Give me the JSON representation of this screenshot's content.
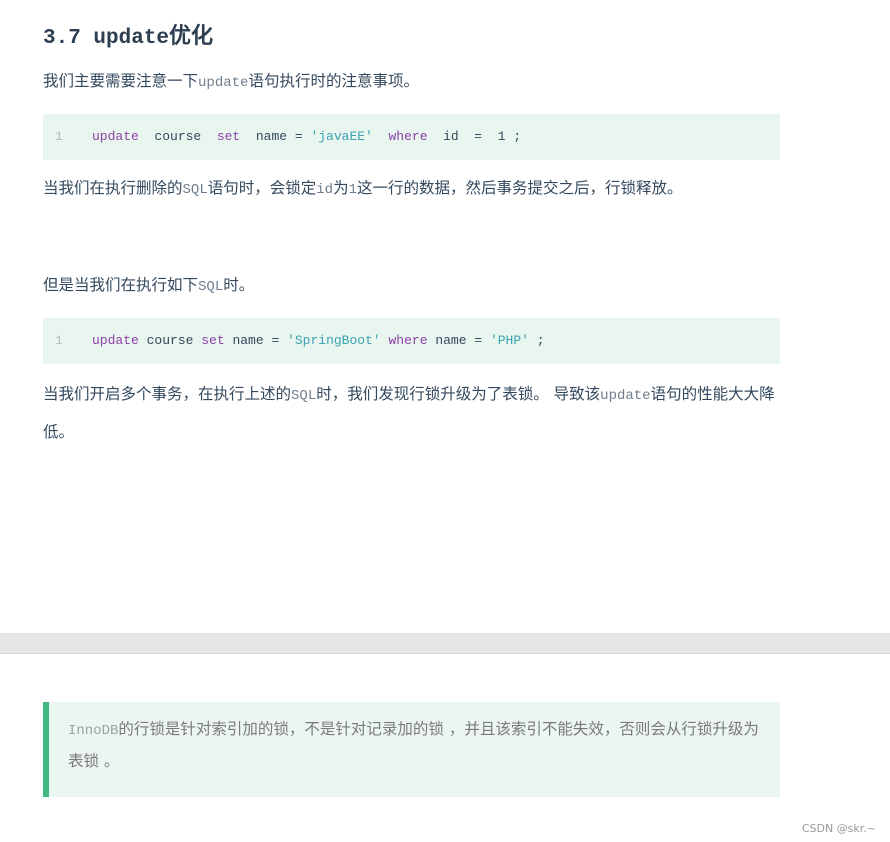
{
  "heading": {
    "code": "3.7 update",
    "suffix": "优化"
  },
  "intro": {
    "pre": "我们主要需要注意一下",
    "code": "update",
    "post": "语句执行时的注意事项。"
  },
  "code1": {
    "line_number": "1",
    "tokens": [
      {
        "t": "update",
        "c": "kw"
      },
      {
        "t": "  course  ",
        "c": ""
      },
      {
        "t": "set",
        "c": "kw"
      },
      {
        "t": "  name = ",
        "c": ""
      },
      {
        "t": "'javaEE'",
        "c": "str"
      },
      {
        "t": "  ",
        "c": ""
      },
      {
        "t": "where",
        "c": "kw"
      },
      {
        "t": "  id  =  1 ;",
        "c": ""
      }
    ]
  },
  "para2": {
    "p1": "当我们在执行删除的",
    "c1": "SQL",
    "p2": "语句时，会锁定",
    "c2": "id",
    "p3": "为",
    "c3": "1",
    "p4": "这一行的数据，然后事务提交之后，行锁释放。"
  },
  "para3": {
    "p1": "但是当我们在执行如下",
    "c1": "SQL",
    "p2": "时。"
  },
  "code2": {
    "line_number": "1",
    "tokens": [
      {
        "t": "update",
        "c": "kw"
      },
      {
        "t": " course ",
        "c": ""
      },
      {
        "t": "set",
        "c": "kw"
      },
      {
        "t": " name = ",
        "c": ""
      },
      {
        "t": "'SpringBoot'",
        "c": "str"
      },
      {
        "t": " ",
        "c": ""
      },
      {
        "t": "where",
        "c": "kw"
      },
      {
        "t": " name = ",
        "c": ""
      },
      {
        "t": "'PHP'",
        "c": "str"
      },
      {
        "t": " ;",
        "c": ""
      }
    ]
  },
  "para4": {
    "p1": "当我们开启多个事务，在执行上述的",
    "c1": "SQL",
    "p2": "时，我们发现行锁升级为了表锁。  导致该",
    "c2": "update",
    "p3": "语句的性能大大降低。"
  },
  "quote": {
    "c1": "InnoDB",
    "p1": "的行锁是针对索引加的锁，不是针对记录加的锁 ，并且该索引不能失效，否则会从行锁升级为表锁  。"
  },
  "watermark": "CSDN @skr.~",
  "colors": {
    "accent": "#42b983",
    "code_bg": "#e8f6ef",
    "keyword": "#8e3fa8",
    "string": "#3aa3b0"
  }
}
